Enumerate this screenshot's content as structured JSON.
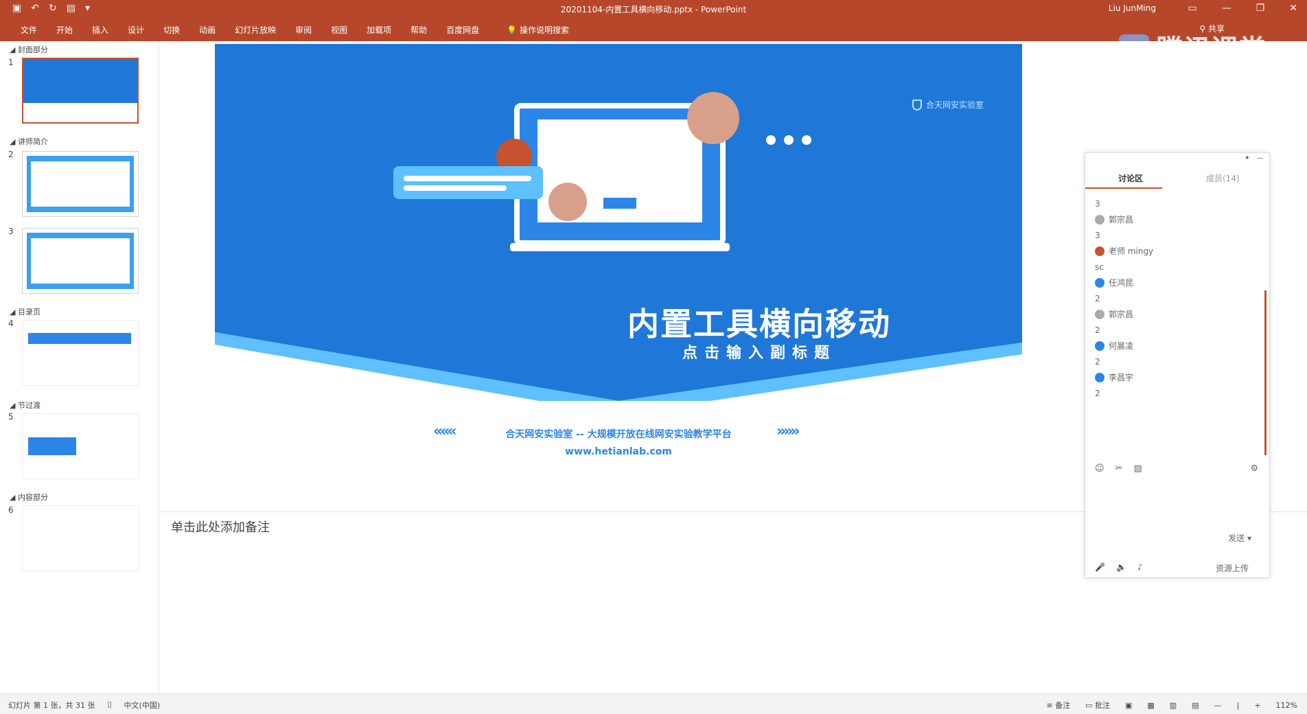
{
  "window": {
    "title": "20201104-内置工具横向移动.pptx - PowerPoint",
    "user": "Liu JunMing"
  },
  "ribbon": {
    "tabs": [
      "文件",
      "开始",
      "插入",
      "设计",
      "切换",
      "动画",
      "幻灯片放映",
      "审阅",
      "视图",
      "加载项",
      "帮助",
      "百度网盘"
    ],
    "tell_me": "操作说明搜索",
    "share": "共享"
  },
  "overlay": {
    "brand": "腾讯课堂"
  },
  "thumbnails": {
    "sections": [
      {
        "label": "封面部分"
      },
      {
        "label": "讲师简介"
      },
      {
        "label": "目录页"
      },
      {
        "label": "节过渡"
      },
      {
        "label": "内容部分"
      }
    ],
    "slides": [
      {
        "num": "1"
      },
      {
        "num": "2"
      },
      {
        "num": "3"
      },
      {
        "num": "4"
      },
      {
        "num": "5"
      },
      {
        "num": "6"
      }
    ]
  },
  "slide": {
    "title": "内置工具横向移动",
    "subtitle": "点击输入副标题",
    "lab_logo": "合天网安实验室",
    "footer_line": "合天网安实验室 -- 大规模开放在线网安实验教学平台",
    "footer_url": "www.hetianlab.com",
    "chev_left": "«««",
    "chev_right": "»»»"
  },
  "notes": {
    "placeholder": "单击此处添加备注"
  },
  "status": {
    "slide_info": "幻灯片 第 1 张，共 31 张",
    "language": "中文(中国)",
    "notes_btn": "备注",
    "comments_btn": "批注",
    "zoom": "112%"
  },
  "chat": {
    "tab_discussion": "讨论区",
    "tab_members": "成员(14)",
    "messages": [
      {
        "text": "3",
        "avatar": false
      },
      {
        "text": "郭宗昌",
        "avatar": true
      },
      {
        "text": "3",
        "avatar": false
      },
      {
        "text": "老师 mingy",
        "avatar": true
      },
      {
        "text": "sc",
        "avatar": false
      },
      {
        "text": "任鸿昆",
        "avatar": true
      },
      {
        "text": "2",
        "avatar": false
      },
      {
        "text": "郭宗昌",
        "avatar": true
      },
      {
        "text": "2",
        "avatar": false
      },
      {
        "text": "何晨凌",
        "avatar": true
      },
      {
        "text": "2",
        "avatar": false
      },
      {
        "text": "李昌宇",
        "avatar": true
      },
      {
        "text": "2",
        "avatar": false
      }
    ],
    "send": "发送",
    "upload": "资源上传"
  },
  "colors": {
    "ribbon": "#b7472a",
    "slide_blue": "#1f77d8",
    "accent_red": "#c6522f",
    "link_blue": "#2b86e8"
  }
}
